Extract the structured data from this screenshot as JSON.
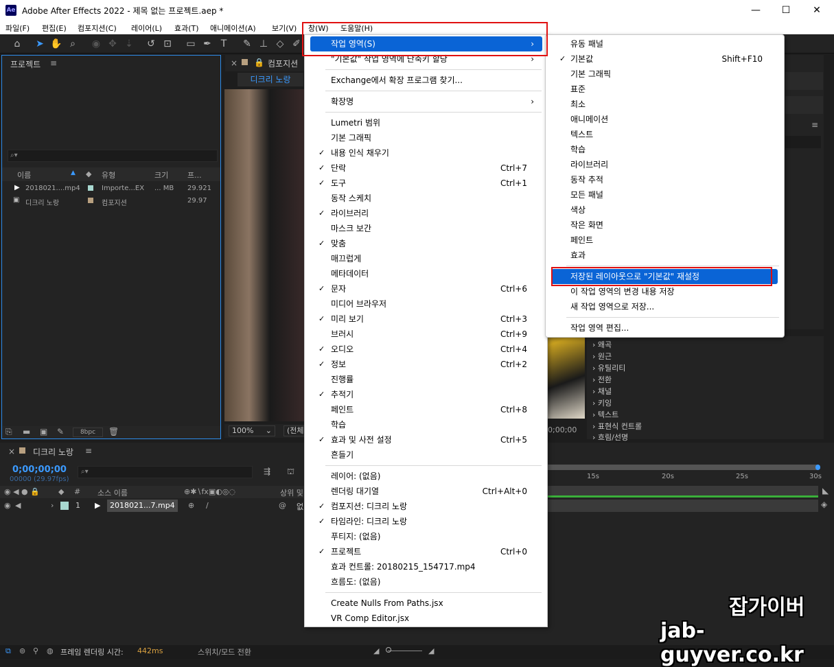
{
  "window": {
    "title": "Adobe After Effects 2022 - 제목 없는 프로젝트.aep *",
    "app_icon": "Ae",
    "minimize": "—",
    "maximize": "☐",
    "close": "✕"
  },
  "menubar": [
    "파일(F)",
    "편집(E)",
    "컴포지션(C)",
    "레이어(L)",
    "효과(T)",
    "애니메이션(A)",
    "보기(V)",
    "창(W)",
    "도움말(H)"
  ],
  "project": {
    "title": "프로젝트",
    "search_placeholder": "⌕▾",
    "columns": [
      "이름",
      "유형",
      "크기",
      "프..."
    ],
    "rows": [
      {
        "name": "2018021....mp4",
        "type": "Importe...EX",
        "size": "... MB",
        "fps": "29.921"
      },
      {
        "name": "디크리 노랑",
        "type": "컴포지션",
        "size": "",
        "fps": "29.97"
      }
    ],
    "bpc": "8bpc"
  },
  "composition": {
    "tab": "컴포지션",
    "subtab": "디크리 노랑",
    "zoom": "100%",
    "view": "(전체",
    "timecode": "0;00;00"
  },
  "effects_list": [
    "왜곡",
    "원근",
    "유틸리티",
    "전환",
    "채널",
    "키잉",
    "텍스트",
    "표현식 컨트롤",
    "흐림/선명"
  ],
  "timeline": {
    "title": "디크리 노랑",
    "time": "0;00;00;00",
    "fps": "00000 (29.97fps)",
    "search_placeholder": "⌕▾",
    "columns": [
      "#",
      "소스 이름",
      "상위 및"
    ],
    "layer": {
      "num": "1",
      "name": "2018021...7.mp4",
      "parent": "없"
    },
    "ruler": [
      "15s",
      "20s",
      "25s",
      "30s"
    ]
  },
  "status": {
    "label": "프레임 렌더링 시간:",
    "value": "442ms",
    "toggle": "스위치/모드 전환"
  },
  "window_menu": {
    "items": [
      {
        "label": "작업 영역(S)",
        "shortcut": "",
        "check": false,
        "arrow": true,
        "highlight": true
      },
      {
        "label": "\"기본값\" 작업 영역에 단축키 할당",
        "shortcut": "",
        "check": false,
        "arrow": true
      },
      {
        "sep": true
      },
      {
        "label": "Exchange에서 확장 프로그램 찾기...",
        "shortcut": "",
        "check": false
      },
      {
        "sep": true
      },
      {
        "label": "확장명",
        "shortcut": "",
        "check": false,
        "arrow": true
      },
      {
        "sep": true
      },
      {
        "label": "Lumetri 범위",
        "shortcut": "",
        "check": false
      },
      {
        "label": "기본 그래픽",
        "shortcut": "",
        "check": false
      },
      {
        "label": "내용 인식 채우기",
        "shortcut": "",
        "check": true
      },
      {
        "label": "단락",
        "shortcut": "Ctrl+7",
        "check": true
      },
      {
        "label": "도구",
        "shortcut": "Ctrl+1",
        "check": true
      },
      {
        "label": "동작 스케치",
        "shortcut": "",
        "check": false
      },
      {
        "label": "라이브러리",
        "shortcut": "",
        "check": true
      },
      {
        "label": "마스크 보간",
        "shortcut": "",
        "check": false
      },
      {
        "label": "맞춤",
        "shortcut": "",
        "check": true
      },
      {
        "label": "매끄럽게",
        "shortcut": "",
        "check": false
      },
      {
        "label": "메타데이터",
        "shortcut": "",
        "check": false
      },
      {
        "label": "문자",
        "shortcut": "Ctrl+6",
        "check": true
      },
      {
        "label": "미디어 브라우저",
        "shortcut": "",
        "check": false
      },
      {
        "label": "미리 보기",
        "shortcut": "Ctrl+3",
        "check": true
      },
      {
        "label": "브러시",
        "shortcut": "Ctrl+9",
        "check": false
      },
      {
        "label": "오디오",
        "shortcut": "Ctrl+4",
        "check": true
      },
      {
        "label": "정보",
        "shortcut": "Ctrl+2",
        "check": true
      },
      {
        "label": "진행률",
        "shortcut": "",
        "check": false
      },
      {
        "label": "추적기",
        "shortcut": "",
        "check": true
      },
      {
        "label": "페인트",
        "shortcut": "Ctrl+8",
        "check": false
      },
      {
        "label": "학습",
        "shortcut": "",
        "check": false
      },
      {
        "label": "효과 및 사전 설정",
        "shortcut": "Ctrl+5",
        "check": true
      },
      {
        "label": "흔들기",
        "shortcut": "",
        "check": false
      },
      {
        "sep": true
      },
      {
        "label": "레이어: (없음)",
        "shortcut": "",
        "check": false
      },
      {
        "label": "렌더링 대기열",
        "shortcut": "Ctrl+Alt+0",
        "check": false
      },
      {
        "label": "컴포지션: 디크리 노랑",
        "shortcut": "",
        "check": true
      },
      {
        "label": "타임라인: 디크리 노랑",
        "shortcut": "",
        "check": true
      },
      {
        "label": "푸티지: (없음)",
        "shortcut": "",
        "check": false
      },
      {
        "label": "프로젝트",
        "shortcut": "Ctrl+0",
        "check": true
      },
      {
        "label": "효과 컨트롤: 20180215_154717.mp4",
        "shortcut": "",
        "check": false
      },
      {
        "label": "흐름도: (없음)",
        "shortcut": "",
        "check": false
      },
      {
        "sep": true
      },
      {
        "label": "Create Nulls From Paths.jsx",
        "shortcut": "",
        "check": false
      },
      {
        "label": "VR Comp Editor.jsx",
        "shortcut": "",
        "check": false
      }
    ]
  },
  "workspace_menu": {
    "items": [
      {
        "label": "유동 패널",
        "shortcut": "",
        "check": false
      },
      {
        "label": "기본값",
        "shortcut": "Shift+F10",
        "check": true
      },
      {
        "label": "기본 그래픽",
        "shortcut": "",
        "check": false
      },
      {
        "label": "표준",
        "shortcut": "",
        "check": false
      },
      {
        "label": "최소",
        "shortcut": "",
        "check": false
      },
      {
        "label": "애니메이션",
        "shortcut": "",
        "check": false
      },
      {
        "label": "텍스트",
        "shortcut": "",
        "check": false
      },
      {
        "label": "학습",
        "shortcut": "",
        "check": false
      },
      {
        "label": "라이브러리",
        "shortcut": "",
        "check": false
      },
      {
        "label": "동작 추적",
        "shortcut": "",
        "check": false
      },
      {
        "label": "모든 패널",
        "shortcut": "",
        "check": false
      },
      {
        "label": "색상",
        "shortcut": "",
        "check": false
      },
      {
        "label": "작은 화면",
        "shortcut": "",
        "check": false
      },
      {
        "label": "페인트",
        "shortcut": "",
        "check": false
      },
      {
        "label": "효과",
        "shortcut": "",
        "check": false
      },
      {
        "sep": true
      },
      {
        "label": "저장된 레이아웃으로 \"기본값\" 재설정",
        "shortcut": "",
        "check": false,
        "highlight": true
      },
      {
        "label": "이 작업 영역의 변경 내용 저장",
        "shortcut": "",
        "check": false
      },
      {
        "label": "새 작업 영역으로 저장...",
        "shortcut": "",
        "check": false
      },
      {
        "sep": true
      },
      {
        "label": "작업 영역 편집...",
        "shortcut": "",
        "check": false
      }
    ]
  },
  "watermark": {
    "line1": "잡가이버",
    "line2": "jab-guyver.co.kr"
  }
}
